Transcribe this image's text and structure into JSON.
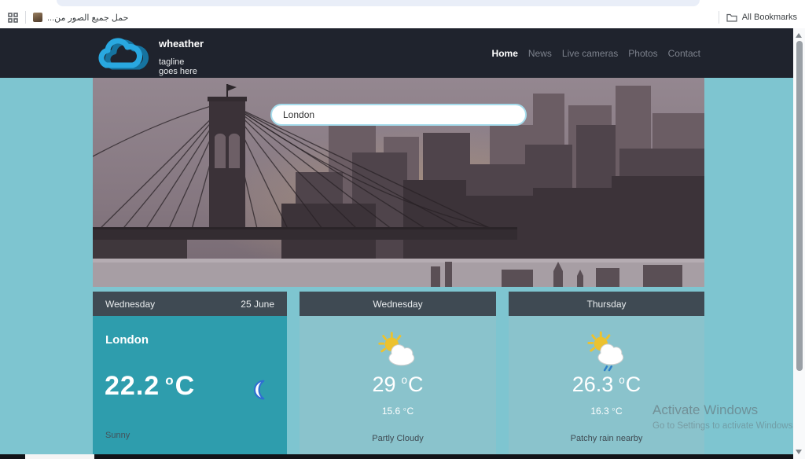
{
  "browser": {
    "bookmarks_bar": {
      "apps_icon": "apps-grid-icon",
      "bookmark_label": "حمل جميع الصور من...",
      "folder_icon": "folder-icon",
      "all_bookmarks_label": "All Bookmarks"
    }
  },
  "navbar": {
    "logo_icon": "cloud-icon",
    "title": "wheather",
    "tagline": "tagline goes here",
    "links": [
      {
        "label": "Home",
        "active": true
      },
      {
        "label": "News",
        "active": false
      },
      {
        "label": "Live cameras",
        "active": false
      },
      {
        "label": "Photos",
        "active": false
      },
      {
        "label": "Contact",
        "active": false
      }
    ]
  },
  "hero": {
    "image_desc": "city skyline with suspension bridge at dusk",
    "search_value": "London"
  },
  "units": {
    "deg_mark": "o",
    "celsius": "C"
  },
  "cards": [
    {
      "day": "Wednesday",
      "date": "25 June",
      "city": "London",
      "temp": "22.2",
      "condition": "Sunny",
      "icon": "moon-icon"
    },
    {
      "day": "Wednesday",
      "temp": "29",
      "low": "15.6",
      "condition": "Partly Cloudy",
      "icon": "sun-cloud-icon"
    },
    {
      "day": "Thursday",
      "temp": "26.3",
      "low": "16.3",
      "condition": "Patchy rain nearby",
      "icon": "sun-rain-icon"
    }
  ],
  "watermark": {
    "line1": "Activate Windows",
    "line2": "Go to Settings to activate Windows."
  },
  "colors": {
    "page_bg": "#7ec5d0",
    "navbar_bg": "#1f232d",
    "logo_blue": "#29a8e0",
    "logo_blue_dark": "#16739f",
    "card_header": "#3f4a53",
    "card_main": "#2e9dad",
    "card_light": "#8ac3cc",
    "search_border": "#a5dcec",
    "sun_yellow": "#ecc22f",
    "rain_blue": "#2f80c8",
    "moon_stroke": "#2f6fd2"
  }
}
